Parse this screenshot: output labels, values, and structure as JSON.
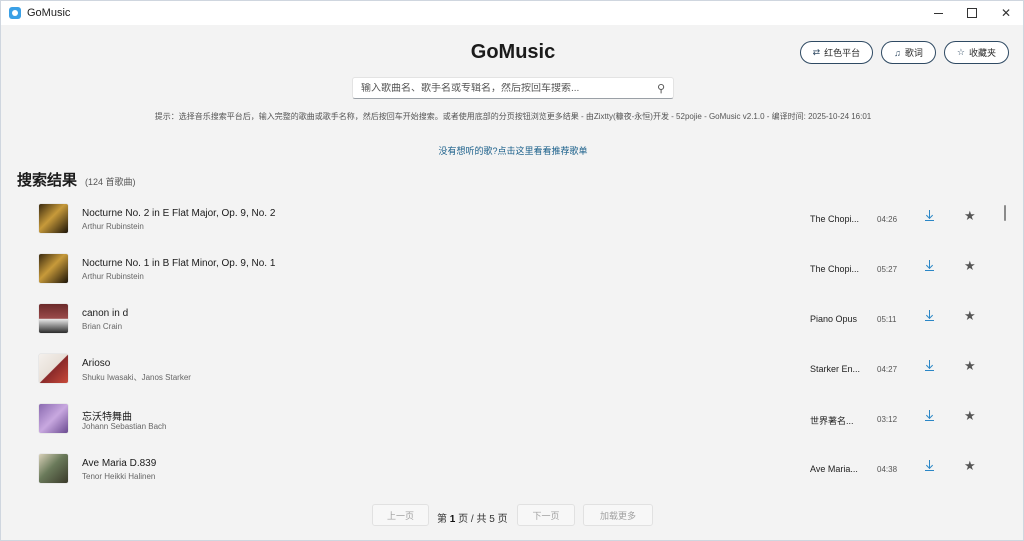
{
  "window": {
    "title": "GoMusic"
  },
  "header": {
    "app_title": "GoMusic",
    "buttons": [
      {
        "icon": "redheart-platform-icon",
        "label": "红色平台"
      },
      {
        "icon": "lyrics-icon",
        "label": "歌词"
      },
      {
        "icon": "star-outline-icon",
        "label": "收藏夹"
      }
    ]
  },
  "search": {
    "placeholder": "输入歌曲名、歌手名或专辑名，然后按回车搜索...",
    "value": ""
  },
  "hint": "提示：选择音乐搜索平台后，输入完整的歌曲或歌手名称，然后按回车开始搜索。或者使用底部的分页按钮浏览更多结果 - 由Zixtty(糠夜-永恒)开发 - 52pojie - GoMusic v2.1.0 - 编译时间: 2025-10-24 16:01",
  "recommend_link": "没有想听的歌?点击这里看看推荐歌单",
  "results": {
    "heading": "搜索结果",
    "count": "(124 首歌曲)",
    "songs": [
      {
        "title": "Nocturne No. 2 in E Flat Major, Op. 9, No. 2",
        "artist": "Arthur Rubinstein",
        "album": "The Chopi...",
        "duration": "04:26"
      },
      {
        "title": "Nocturne No. 1 in B Flat Minor, Op. 9, No. 1",
        "artist": "Arthur Rubinstein",
        "album": "The Chopi...",
        "duration": "05:27"
      },
      {
        "title": "canon in d",
        "artist": "Brian Crain",
        "album": "Piano Opus",
        "duration": "05:11"
      },
      {
        "title": "Arioso",
        "artist": "Shuku Iwasaki、Janos Starker",
        "album": "Starker En...",
        "duration": "04:27"
      },
      {
        "title": "忘沃特舞曲",
        "artist": "Johann Sebastian Bach",
        "album": "世界著名...",
        "duration": "03:12"
      },
      {
        "title": "Ave Maria D.839",
        "artist": "Tenor Heikki Halinen",
        "album": "Ave Maria...",
        "duration": "04:38"
      }
    ]
  },
  "pagination": {
    "prev_label": "上一页",
    "status_prefix": "第",
    "current_page": "1",
    "status_mid": "页 / 共",
    "total_pages": "5",
    "status_suffix": "页",
    "next_label": "下一页",
    "load_more_label": "加载更多"
  },
  "colors": {
    "accent": "#2a86c6",
    "link": "#1a5f8a",
    "pill_border": "#2f4a63"
  }
}
